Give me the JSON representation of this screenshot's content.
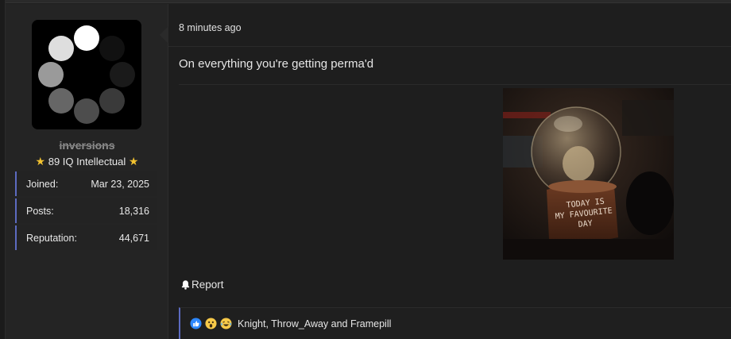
{
  "user": {
    "username": "inversions",
    "title": "89 IQ Intellectual",
    "stats": [
      {
        "label": "Joined:",
        "value": "Mar 23, 2025"
      },
      {
        "label": "Posts:",
        "value": "18,316"
      },
      {
        "label": "Reputation:",
        "value": "44,671"
      }
    ]
  },
  "post": {
    "timestamp": "8 minutes ago",
    "body": "On everything you're getting perma'd",
    "image_text": [
      "TODAY IS",
      "MY FAVOURITE",
      "DAY"
    ],
    "report_label": "Report"
  },
  "reactions": {
    "icons": [
      "like-icon",
      "wow-icon",
      "cry-laugh-icon"
    ],
    "names": "Knight, Throw_Away and Framepill"
  },
  "colors": {
    "accent": "#5c6bc0",
    "star": "#f2c230",
    "background": "#1e1e1e",
    "sidebar": "#242424"
  }
}
